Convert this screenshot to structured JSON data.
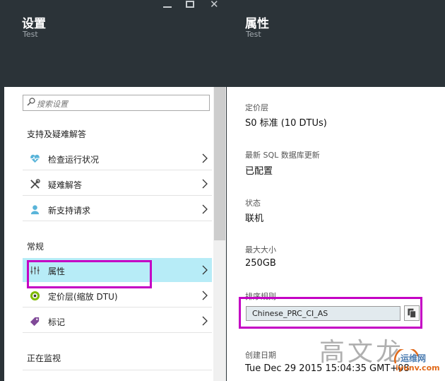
{
  "settings_blade": {
    "title": "设置",
    "subtitle": "Test",
    "search": {
      "placeholder": "搜索设置"
    },
    "sections": [
      {
        "label": "支持及疑难解答",
        "items": [
          {
            "label": "检查运行状况",
            "icon": "heart-pulse-icon"
          },
          {
            "label": "疑难解答",
            "icon": "tools-icon"
          },
          {
            "label": "新支持请求",
            "icon": "support-person-icon"
          }
        ]
      },
      {
        "label": "常规",
        "items": [
          {
            "label": "属性",
            "icon": "sliders-icon",
            "selected": true
          },
          {
            "label": "定价层(缩放 DTU)",
            "icon": "pricing-tier-icon"
          },
          {
            "label": "标记",
            "icon": "tag-icon"
          }
        ]
      },
      {
        "label": "正在监视",
        "items": []
      }
    ]
  },
  "properties_blade": {
    "title": "属性",
    "subtitle": "Test",
    "fields": [
      {
        "label": "定价层",
        "value": "S0 标准 (10 DTUs)"
      },
      {
        "label": "最新 SQL 数据库更新",
        "value": "已配置"
      },
      {
        "label": "状态",
        "value": "联机"
      },
      {
        "label": "最大大小",
        "value": "250GB"
      },
      {
        "label": "排序规则",
        "value": "Chinese_PRC_CI_AS"
      },
      {
        "label": "创建日期",
        "value": "Tue Dec 29 2015 15:04:35 GMT+08"
      }
    ]
  },
  "watermark": {
    "text": "高文龙",
    "site": "运维网",
    "url": "iyunv.com"
  },
  "colors": {
    "header_bg": "#2b3338",
    "selected_bg": "#b7ecf7",
    "annotation": "#c400c4"
  }
}
